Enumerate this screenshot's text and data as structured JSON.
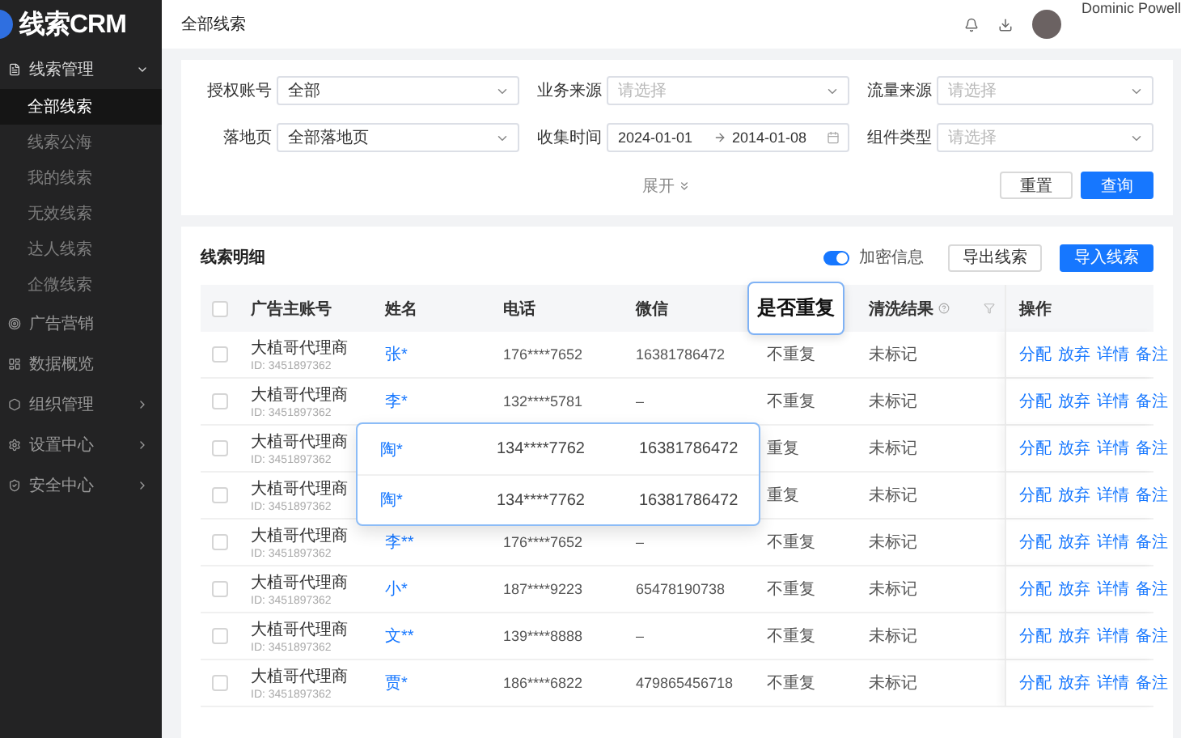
{
  "sidebar": {
    "logo": "线索CRM",
    "items": [
      {
        "label": "线索管理",
        "kind": "group",
        "expanded": true,
        "children": [
          {
            "label": "全部线索",
            "selected": true
          },
          {
            "label": "线索公海",
            "selected": false
          },
          {
            "label": "我的线索",
            "selected": false
          },
          {
            "label": "无效线索",
            "selected": false
          },
          {
            "label": "达人线索",
            "selected": false
          },
          {
            "label": "企微线索",
            "selected": false
          }
        ]
      },
      {
        "label": "广告营销",
        "kind": "link"
      },
      {
        "label": "数据概览",
        "kind": "link"
      },
      {
        "label": "组织管理",
        "kind": "group",
        "expanded": false
      },
      {
        "label": "设置中心",
        "kind": "group",
        "expanded": false
      },
      {
        "label": "安全中心",
        "kind": "group",
        "expanded": false
      }
    ]
  },
  "header": {
    "title": "全部线索",
    "user": "Dominic Powell"
  },
  "filters": [
    {
      "label": "授权账号",
      "kind": "select",
      "value": "全部"
    },
    {
      "label": "业务来源",
      "kind": "select",
      "placeholder": "请选择"
    },
    {
      "label": "流量来源",
      "kind": "select",
      "placeholder": "请选择"
    },
    {
      "label": "落地页",
      "kind": "select",
      "value": "全部落地页"
    },
    {
      "label": "收集时间",
      "kind": "daterange",
      "start": "2024-01-01",
      "end": "2014-01-08"
    },
    {
      "label": "组件类型",
      "kind": "select",
      "placeholder": "请选择"
    }
  ],
  "expand_link": "展开",
  "filter_buttons": [
    {
      "label": "重置",
      "kind": "default"
    },
    {
      "label": "查询",
      "kind": "primary"
    }
  ],
  "table": {
    "title": "线索明细",
    "encrypt_toggle": {
      "label": "加密信息",
      "on": true
    },
    "buttons": [
      {
        "label": "导出线索",
        "kind": "default"
      },
      {
        "label": "导入线索",
        "kind": "primary"
      }
    ],
    "all_checked": false,
    "columns": [
      {
        "label": "广告主账号",
        "highlighted": false
      },
      {
        "label": "姓名",
        "highlighted": false
      },
      {
        "label": "电话",
        "highlighted": false
      },
      {
        "label": "微信",
        "highlighted": false
      },
      {
        "label": "是否重复",
        "highlighted": true
      },
      {
        "label": "清洗结果",
        "highlighted": false,
        "help": true,
        "filterable": true
      },
      {
        "label": "操作",
        "highlighted": false
      }
    ],
    "rows": [
      {
        "checked": false,
        "account": "大植哥代理商",
        "id": "ID: 3451897362",
        "name": "张*",
        "phone": "176****7652",
        "wechat": "16381786472",
        "duplicate": "不重复",
        "clean": "未标记",
        "actions": [
          "分配",
          "放弃",
          "详情",
          "备注"
        ]
      },
      {
        "checked": false,
        "account": "大植哥代理商",
        "id": "ID: 3451897362",
        "name": "李*",
        "phone": "132****5781",
        "wechat": "–",
        "duplicate": "不重复",
        "clean": "未标记",
        "actions": [
          "分配",
          "放弃",
          "详情",
          "备注"
        ]
      },
      {
        "checked": false,
        "account": "大植哥代理商",
        "id": "ID: 3451897362",
        "duplicate": "重复",
        "clean": "未标记",
        "actions": [
          "分配",
          "放弃",
          "详情",
          "备注"
        ]
      },
      {
        "checked": false,
        "account": "大植哥代理商",
        "id": "ID: 3451897362",
        "duplicate": "重复",
        "clean": "未标记",
        "actions": [
          "分配",
          "放弃",
          "详情",
          "备注"
        ]
      },
      {
        "checked": false,
        "account": "大植哥代理商",
        "id": "ID: 3451897362",
        "name": "李**",
        "phone": "176****7652",
        "wechat": "–",
        "duplicate": "不重复",
        "clean": "未标记",
        "actions": [
          "分配",
          "放弃",
          "详情",
          "备注"
        ]
      },
      {
        "checked": false,
        "account": "大植哥代理商",
        "id": "ID: 3451897362",
        "name": "小*",
        "phone": "187****9223",
        "wechat": "65478190738",
        "duplicate": "不重复",
        "clean": "未标记",
        "actions": [
          "分配",
          "放弃",
          "详情",
          "备注"
        ]
      },
      {
        "checked": false,
        "account": "大植哥代理商",
        "id": "ID: 3451897362",
        "name": "文**",
        "phone": "139****8888",
        "wechat": "–",
        "duplicate": "不重复",
        "clean": "未标记",
        "actions": [
          "分配",
          "放弃",
          "详情",
          "备注"
        ]
      },
      {
        "checked": false,
        "account": "大植哥代理商",
        "id": "ID: 3451897362",
        "name": "贾*",
        "phone": "186****6822",
        "wechat": "479865456718",
        "duplicate": "不重复",
        "clean": "未标记",
        "actions": [
          "分配",
          "放弃",
          "详情",
          "备注"
        ]
      }
    ],
    "floating_card": {
      "rows": [
        {
          "name": "陶*",
          "phone": "134****7762",
          "wechat": "16381786472"
        },
        {
          "name": "陶*",
          "phone": "134****7762",
          "wechat": "16381786472"
        }
      ]
    }
  }
}
